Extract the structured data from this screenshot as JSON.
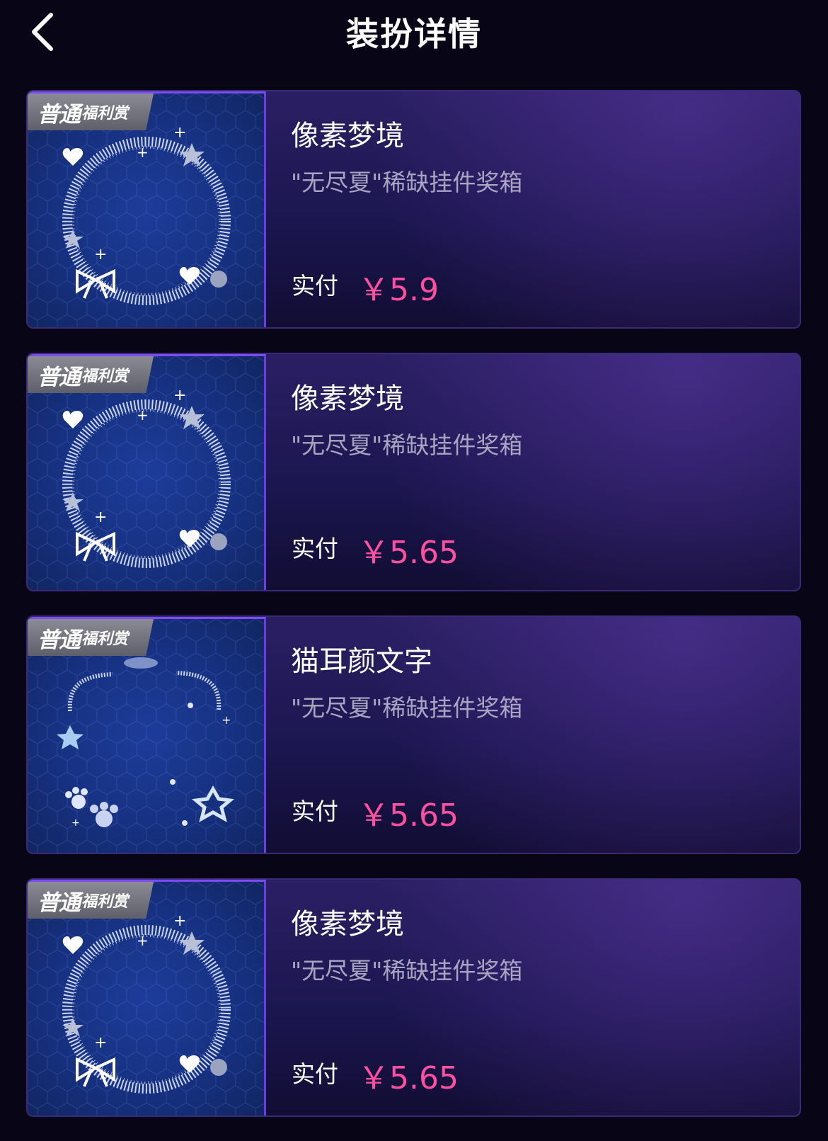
{
  "header": {
    "title": "装扮详情",
    "back_icon": "chevron-left-icon"
  },
  "colors": {
    "background": "#080616",
    "price": "#ff4fa0",
    "accent_border": "#6a3fe0",
    "badge": "#7a7a86"
  },
  "items": [
    {
      "badge_main": "普通",
      "badge_sub": "福利赏",
      "art": "frame-ring",
      "name": "像素梦境",
      "source": "\"无尽夏\"稀缺挂件奖箱",
      "paid_label": "实付",
      "price": "￥5.9"
    },
    {
      "badge_main": "普通",
      "badge_sub": "福利赏",
      "art": "frame-ring",
      "name": "像素梦境",
      "source": "\"无尽夏\"稀缺挂件奖箱",
      "paid_label": "实付",
      "price": "￥5.65"
    },
    {
      "badge_main": "普通",
      "badge_sub": "福利赏",
      "art": "cat-ears",
      "name": "猫耳颜文字",
      "source": "\"无尽夏\"稀缺挂件奖箱",
      "paid_label": "实付",
      "price": "￥5.65"
    },
    {
      "badge_main": "普通",
      "badge_sub": "福利赏",
      "art": "frame-ring",
      "name": "像素梦境",
      "source": "\"无尽夏\"稀缺挂件奖箱",
      "paid_label": "实付",
      "price": "￥5.65"
    }
  ]
}
